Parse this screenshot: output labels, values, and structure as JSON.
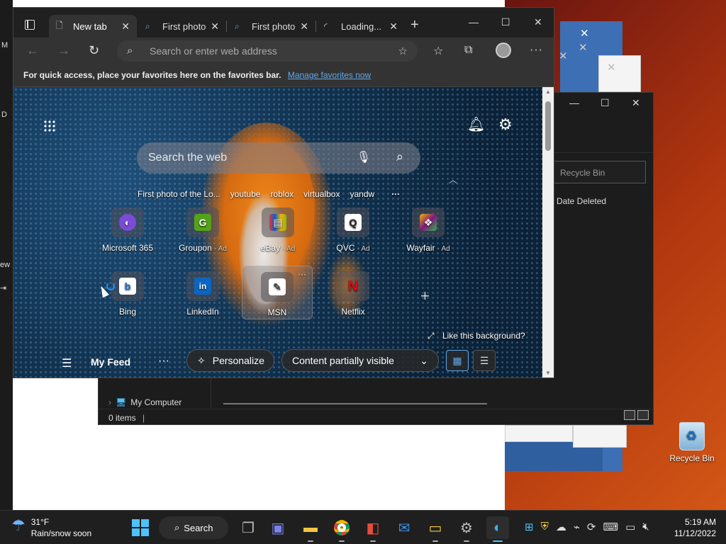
{
  "edge": {
    "tabs": [
      {
        "title": "New tab",
        "icon": "page-icon",
        "active": true
      },
      {
        "title": "First photo",
        "icon": "search-icon",
        "active": false
      },
      {
        "title": "First photo",
        "icon": "search-icon",
        "active": false
      },
      {
        "title": "Loading...",
        "icon": "loading-icon",
        "active": false
      }
    ],
    "address_placeholder": "Search or enter web address",
    "favbar_text": "For quick access, place your favorites here on the favorites bar.",
    "favbar_link": "Manage favorites now"
  },
  "newtab": {
    "search_placeholder": "Search the web",
    "quick_links": [
      "First photo of the Lo...",
      "youtube",
      "roblox",
      "virtualbox",
      "yandw"
    ],
    "quick_links_more": "···",
    "tiles": [
      {
        "label": "Microsoft 365",
        "ad": "",
        "color": "#7b4bd6",
        "glyph": "◐"
      },
      {
        "label": "Groupon",
        "ad": "· Ad",
        "color": "#53a318",
        "glyph": "G"
      },
      {
        "label": "eBay",
        "ad": "· Ad",
        "color": "#e53238",
        "glyph": "▤"
      },
      {
        "label": "QVC",
        "ad": "· Ad",
        "color": "#ffffff",
        "glyph": "Q"
      },
      {
        "label": "Wayfair",
        "ad": "· Ad",
        "color": "#7f187f",
        "glyph": "❖"
      },
      {
        "label": "Bing",
        "ad": "",
        "color": "#ffffff",
        "glyph": "b"
      },
      {
        "label": "LinkedIn",
        "ad": "",
        "color": "#0a66c2",
        "glyph": "in"
      },
      {
        "label": "MSN",
        "ad": "",
        "color": "#ffffff",
        "glyph": "✎"
      },
      {
        "label": "Netflix",
        "ad": "",
        "color": "#e50914",
        "glyph": "N"
      }
    ],
    "like_background": "Like this background?",
    "my_feed": "My Feed",
    "personalize": "Personalize",
    "content_visibility": "Content partially visible"
  },
  "explorer": {
    "search_placeholder": "Recycle Bin",
    "column_date_deleted": "Date Deleted",
    "tree_item": "My Computer",
    "status": "0 items"
  },
  "desktop": {
    "recycle_bin_label": "Recycle Bin"
  },
  "taskbar": {
    "weather_temp": "31°F",
    "weather_desc": "Rain/snow soon",
    "search_label": "Search",
    "time": "5:19 AM",
    "date": "11/12/2022"
  }
}
